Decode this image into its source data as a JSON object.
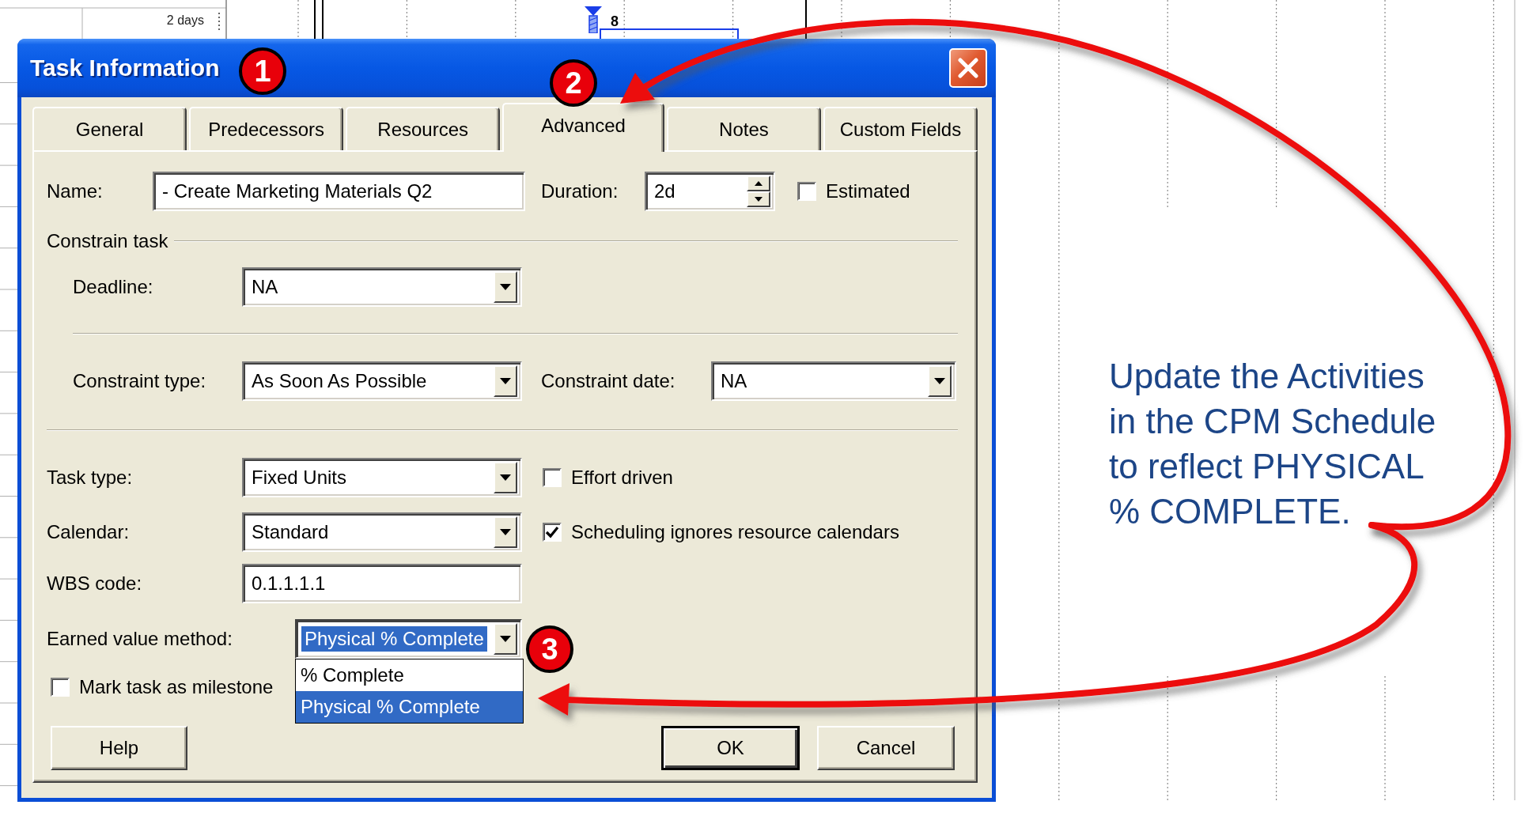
{
  "gantt": {
    "duration": "2 days",
    "bar_label": "8"
  },
  "dialog": {
    "title": "Task Information",
    "tabs": [
      {
        "label": "General",
        "selected": false
      },
      {
        "label": "Predecessors",
        "selected": false
      },
      {
        "label": "Resources",
        "selected": false
      },
      {
        "label": "Advanced",
        "selected": true
      },
      {
        "label": "Notes",
        "selected": false
      },
      {
        "label": "Custom Fields",
        "selected": false
      }
    ],
    "name": {
      "label": "Name:",
      "value": "- Create Marketing Materials Q2"
    },
    "duration": {
      "label": "Duration:",
      "value": "2d"
    },
    "estimated": {
      "label": "Estimated",
      "checked": false
    },
    "constrain_task": {
      "heading": "Constrain task",
      "deadline": {
        "label": "Deadline:",
        "value": "NA"
      },
      "constraint_type": {
        "label": "Constraint type:",
        "value": "As Soon As Possible"
      },
      "constraint_date": {
        "label": "Constraint date:",
        "value": "NA"
      }
    },
    "task_type": {
      "label": "Task type:",
      "value": "Fixed Units"
    },
    "effort_driven": {
      "label": "Effort driven",
      "checked": false
    },
    "calendar": {
      "label": "Calendar:",
      "value": "Standard"
    },
    "scheduling_ignores_resource_calendars": {
      "label": "Scheduling ignores resource calendars",
      "checked": true
    },
    "wbs_code": {
      "label": "WBS code:",
      "value": "0.1.1.1.1"
    },
    "earned_value_method": {
      "label": "Earned value method:",
      "value": "Physical % Complete",
      "focused": true,
      "expanded": true,
      "options": [
        {
          "label": "% Complete",
          "selected": false
        },
        {
          "label": "Physical % Complete",
          "selected": true
        }
      ]
    },
    "mark_as_milestone": {
      "label": "Mark task as milestone",
      "checked": false
    },
    "buttons": [
      {
        "label": "Help",
        "default": false
      },
      {
        "label": "OK",
        "default": true
      },
      {
        "label": "Cancel",
        "default": false
      }
    ]
  },
  "callouts": [
    "1",
    "2",
    "3"
  ],
  "note": "Update the Activities in the CPM Schedule to reflect PHYSICAL % COMPLETE."
}
